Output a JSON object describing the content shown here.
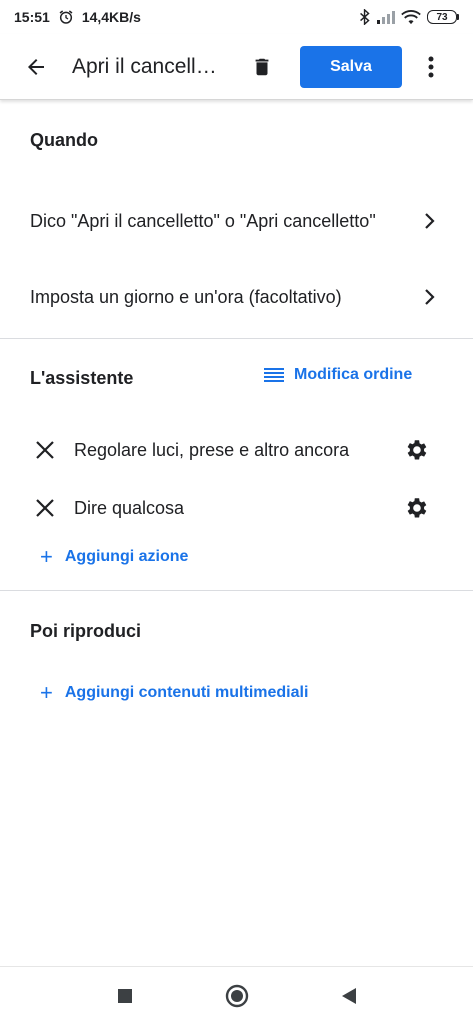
{
  "status_bar": {
    "time": "15:51",
    "speed": "14,4KB/s",
    "battery": "73",
    "icons": [
      "alarm-icon",
      "bluetooth-icon",
      "signal-icon",
      "wifi-icon",
      "battery-icon"
    ]
  },
  "app_bar": {
    "title": "Apri il cancelletto",
    "save_label": "Salva",
    "icons": [
      "back-arrow-icon",
      "trash-icon",
      "more-vert-icon"
    ]
  },
  "when_section": {
    "title": "Quando",
    "rows": [
      {
        "label": "Dico \"Apri il cancelletto\" o \"Apri cancelletto\""
      },
      {
        "label": "Imposta un giorno e un'ora (facoltativo)"
      }
    ]
  },
  "assistant_section": {
    "title": "L'assistente",
    "reorder_label": "Modifica ordine",
    "actions": [
      {
        "label": "Regolare luci, prese e altro ancora"
      },
      {
        "label": "Dire qualcosa"
      }
    ],
    "add_action_label": "Aggiungi azione"
  },
  "media_section": {
    "title": "Poi riproduci",
    "add_media_label": "Aggiungi contenuti multimediali"
  },
  "colors": {
    "accent": "#1a73e8",
    "text": "#202124",
    "divider": "#dadce0"
  }
}
